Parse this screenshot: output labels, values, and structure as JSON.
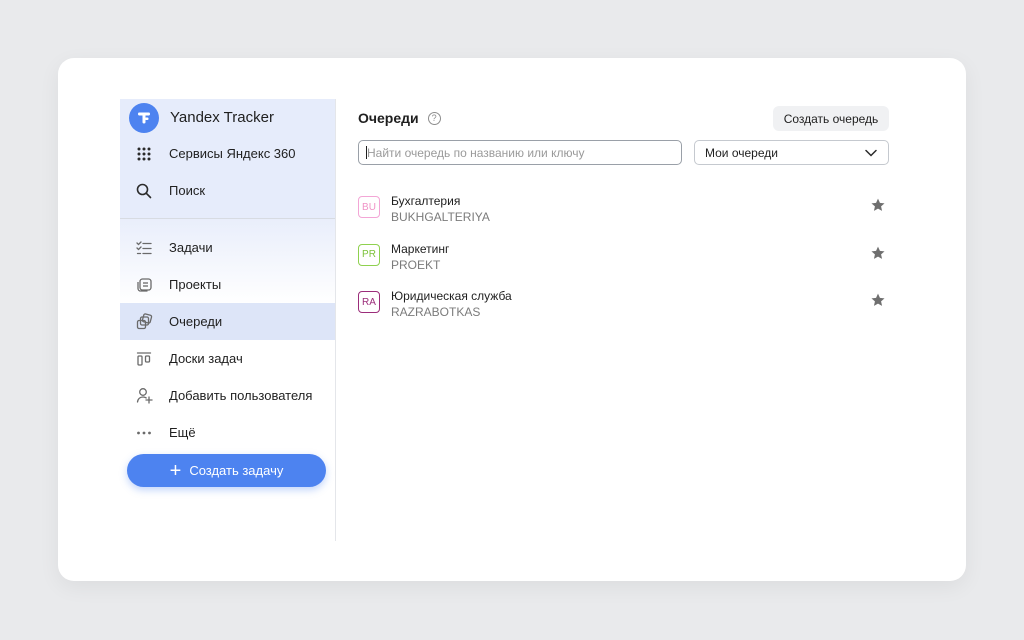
{
  "sidebar": {
    "app_name": "Yandex Tracker",
    "top_items": [
      {
        "label": "Сервисы Яндекс 360",
        "icon": "grid-icon"
      },
      {
        "label": "Поиск",
        "icon": "search-icon"
      }
    ],
    "nav_items": [
      {
        "label": "Задачи",
        "icon": "tasks-icon"
      },
      {
        "label": "Проекты",
        "icon": "projects-icon"
      },
      {
        "label": "Очереди",
        "icon": "queues-icon",
        "active": true
      },
      {
        "label": "Доски задач",
        "icon": "boards-icon"
      },
      {
        "label": "Добавить пользователя",
        "icon": "add-user-icon"
      },
      {
        "label": "Ещё",
        "icon": "more-icon"
      }
    ],
    "create_task_label": "Создать задачу"
  },
  "main": {
    "title": "Очереди",
    "create_queue_label": "Создать очередь",
    "search_placeholder": "Найти очередь по названию или ключу",
    "filter_selected": "Мои очереди",
    "queues": [
      {
        "badge": "BU",
        "name": "Бухгалтерия",
        "key": "BUKHGALTERIYA",
        "color": "#f3a6d6"
      },
      {
        "badge": "PR",
        "name": "Маркетинг",
        "key": "PROEKT",
        "color": "#8fd14f"
      },
      {
        "badge": "RA",
        "name": "Юридическая служба",
        "key": "RAZRABOTKAS",
        "color": "#9b2d7a"
      }
    ]
  },
  "colors": {
    "accent": "#4d83f0",
    "sidebar_bg": "#e6ecfb",
    "active_item_bg": "#dde5f8",
    "star": "#6f6f6f"
  }
}
